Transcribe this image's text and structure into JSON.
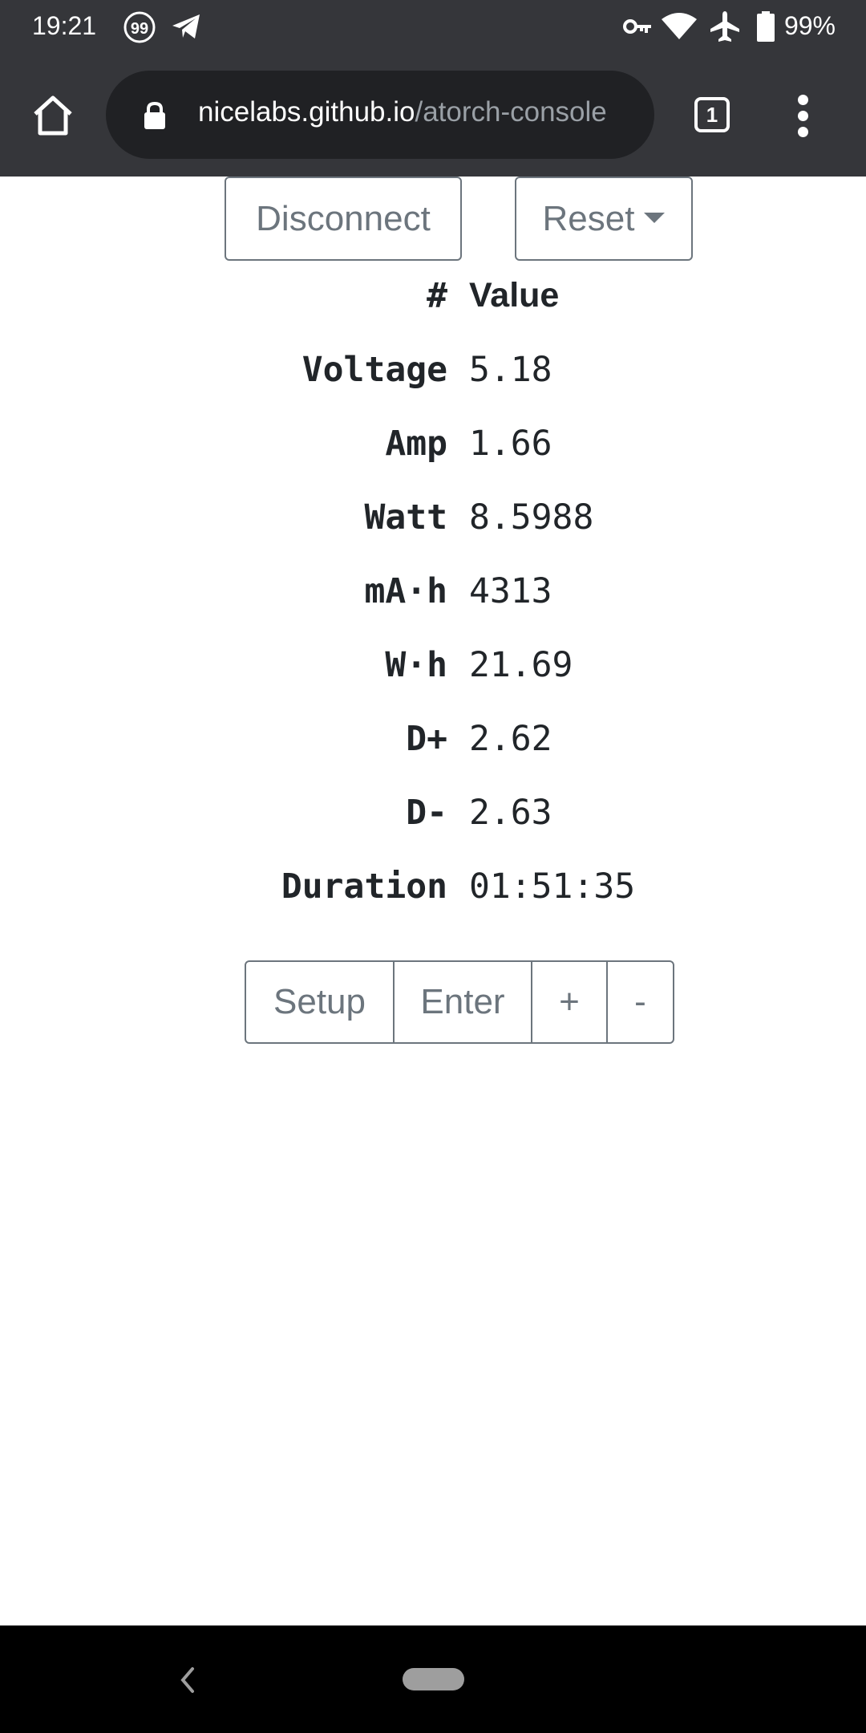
{
  "status_bar": {
    "time": "19:21",
    "notification_badge": "99",
    "battery": "99%"
  },
  "browser": {
    "url_host": "nicelabs.github.io",
    "url_path": "/atorch-console",
    "tab_count": "1"
  },
  "page": {
    "disconnect_label": "Disconnect",
    "reset_label": "Reset",
    "table": {
      "header_label": "#",
      "header_value": "Value",
      "rows": [
        {
          "label": "Voltage",
          "value": "5.18"
        },
        {
          "label": "Amp",
          "value": "1.66"
        },
        {
          "label": "Watt",
          "value": "8.5988"
        },
        {
          "label": "mA·h",
          "value": "4313"
        },
        {
          "label": "W·h",
          "value": "21.69"
        },
        {
          "label": "D+",
          "value": "2.62"
        },
        {
          "label": "D-",
          "value": "2.63"
        },
        {
          "label": "Duration",
          "value": "01:51:35"
        }
      ]
    },
    "controls": {
      "setup_label": "Setup",
      "enter_label": "Enter",
      "plus_label": "+",
      "minus_label": "-"
    }
  }
}
